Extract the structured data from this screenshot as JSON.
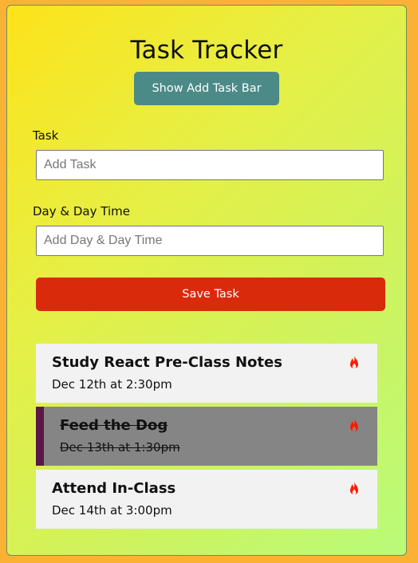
{
  "app": {
    "title": "Task Tracker",
    "toggle_label": "Show Add Task Bar"
  },
  "form": {
    "task_label": "Task",
    "task_placeholder": "Add Task",
    "day_label": "Day & Day Time",
    "day_placeholder": "Add Day & Day Time",
    "save_label": "Save Task"
  },
  "tasks": [
    {
      "text": "Study React Pre-Class Notes",
      "day": "Dec 12th at 2:30pm",
      "reminder": false
    },
    {
      "text": "Feed the Dog",
      "day": "Dec 13th at 1:30pm",
      "reminder": true
    },
    {
      "text": "Attend In-Class",
      "day": "Dec 14th at 3:00pm",
      "reminder": false
    }
  ],
  "colors": {
    "page_bg": "#fbb134",
    "toggle_button": "#4b8a87",
    "save_button": "#d92a0b",
    "task_bg": "#f2f2f2",
    "task_reminder_bg": "#858585",
    "task_reminder_border": "#5a1745",
    "delete_icon": "#ff1a00"
  },
  "icons": {
    "delete": "flame-icon"
  }
}
